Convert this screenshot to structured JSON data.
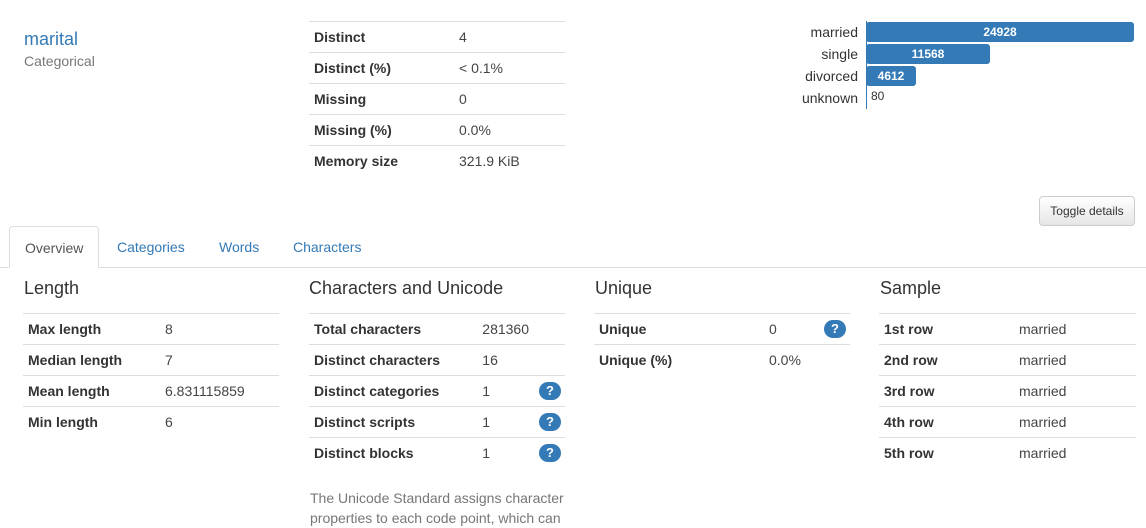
{
  "variable": {
    "name": "marital",
    "type": "Categorical"
  },
  "summary": {
    "rows": [
      {
        "label": "Distinct",
        "value": "4"
      },
      {
        "label": "Distinct (%)",
        "value": "< 0.1%"
      },
      {
        "label": "Missing",
        "value": "0"
      },
      {
        "label": "Missing (%)",
        "value": "0.0%"
      },
      {
        "label": "Memory size",
        "value": "321.9 KiB"
      }
    ]
  },
  "value_counts": {
    "items": [
      {
        "label": "married",
        "count": 24928,
        "count_text": "24928"
      },
      {
        "label": "single",
        "count": 11568,
        "count_text": "11568"
      },
      {
        "label": "divorced",
        "count": 4612,
        "count_text": "4612"
      },
      {
        "label": "unknown",
        "count": 80,
        "count_text": "80"
      }
    ],
    "bar_color": "#337ab7"
  },
  "toggle_label": "Toggle details",
  "tabs": [
    {
      "label": "Overview",
      "active": true
    },
    {
      "label": "Categories",
      "active": false
    },
    {
      "label": "Words",
      "active": false
    },
    {
      "label": "Characters",
      "active": false
    }
  ],
  "length": {
    "title": "Length",
    "rows": [
      {
        "label": "Max length",
        "value": "8"
      },
      {
        "label": "Median length",
        "value": "7"
      },
      {
        "label": "Mean length",
        "value": "6.831115859"
      },
      {
        "label": "Min length",
        "value": "6"
      }
    ]
  },
  "unicode": {
    "title": "Characters and Unicode",
    "rows": [
      {
        "label": "Total characters",
        "value": "281360",
        "help": false
      },
      {
        "label": "Distinct characters",
        "value": "16",
        "help": false
      },
      {
        "label": "Distinct categories",
        "value": "1",
        "help": true
      },
      {
        "label": "Distinct scripts",
        "value": "1",
        "help": true
      },
      {
        "label": "Distinct blocks",
        "value": "1",
        "help": true
      }
    ],
    "note": "The Unicode Standard assigns character properties to each code point, which can"
  },
  "unique": {
    "title": "Unique",
    "rows": [
      {
        "label": "Unique",
        "value": "0",
        "help": true
      },
      {
        "label": "Unique (%)",
        "value": "0.0%",
        "help": false
      }
    ]
  },
  "sample": {
    "title": "Sample",
    "rows": [
      {
        "label": "1st row",
        "value": "married"
      },
      {
        "label": "2nd row",
        "value": "married"
      },
      {
        "label": "3rd row",
        "value": "married"
      },
      {
        "label": "4th row",
        "value": "married"
      },
      {
        "label": "5th row",
        "value": "married"
      }
    ]
  },
  "help_icon_glyph": "?"
}
